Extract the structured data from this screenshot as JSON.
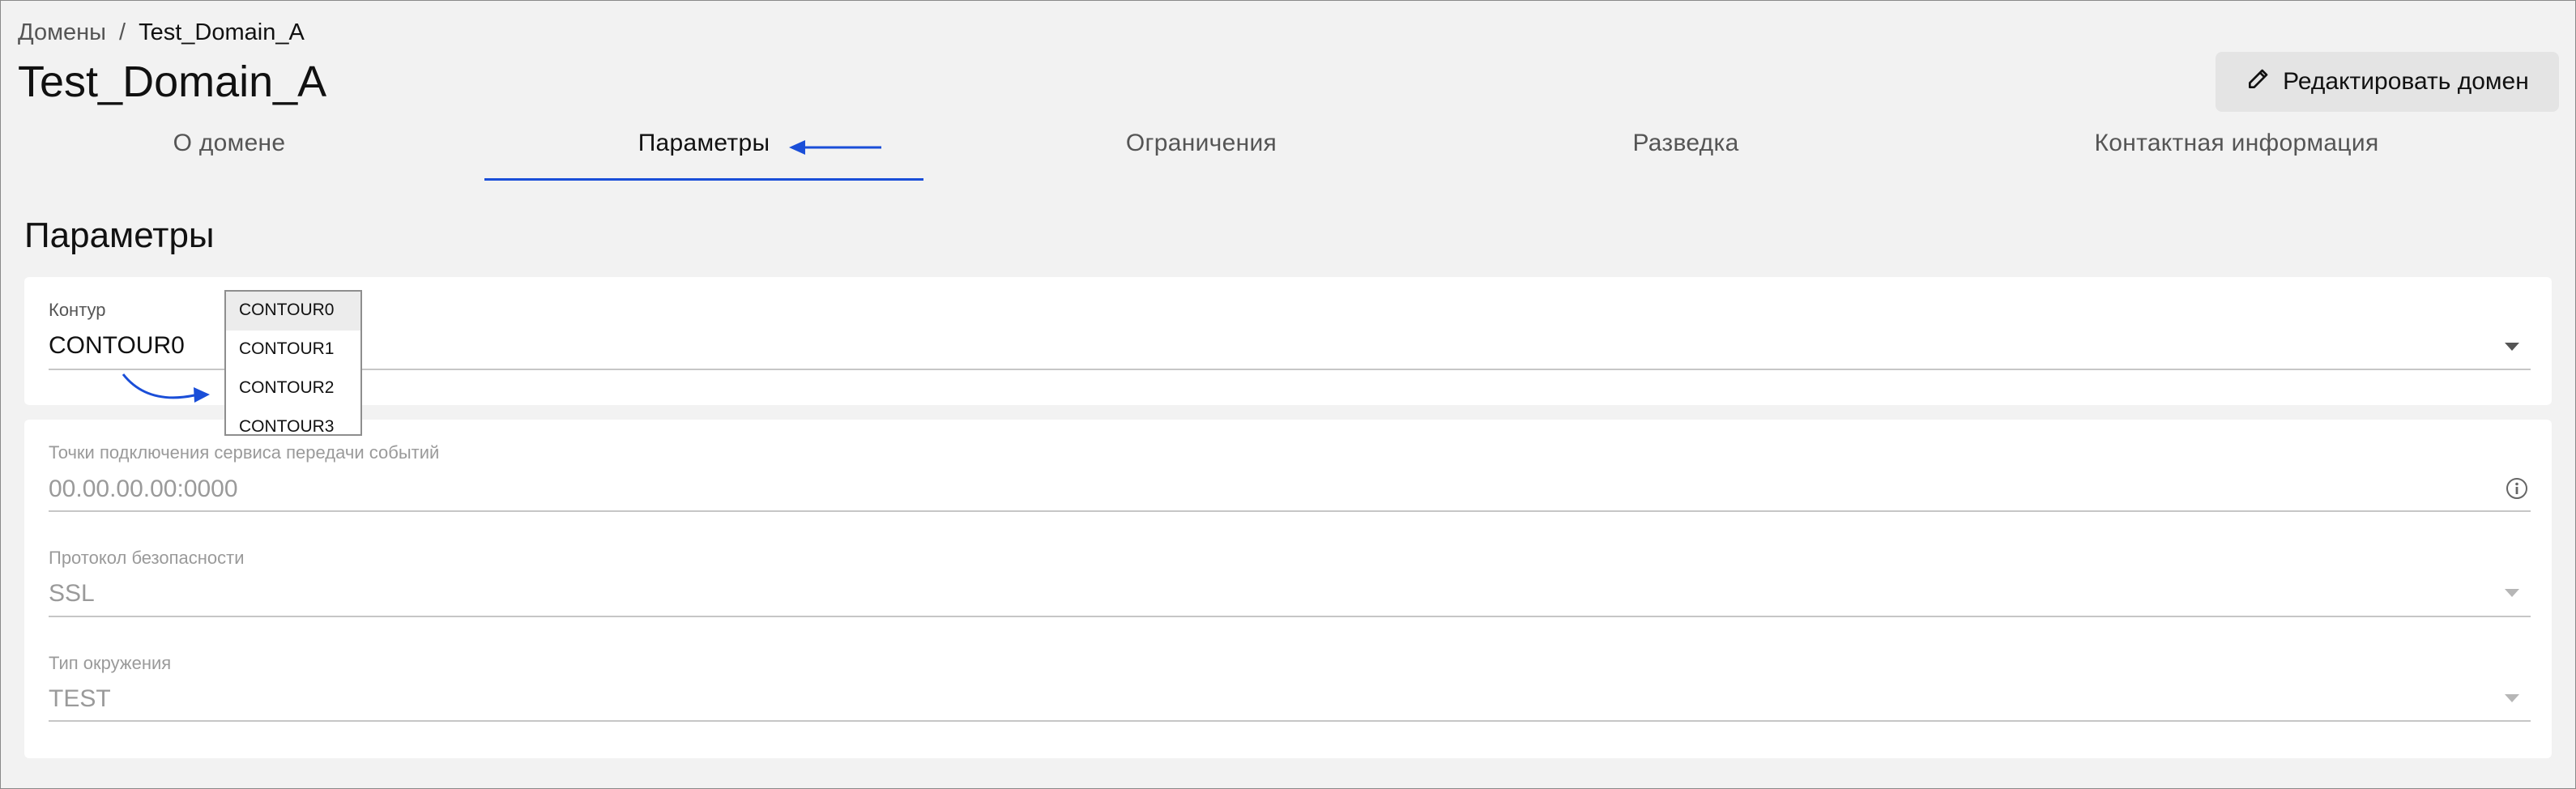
{
  "breadcrumb": {
    "root": "Домены",
    "separator": "/",
    "current": "Test_Domain_A"
  },
  "page": {
    "title": "Test_Domain_A",
    "edit_button_label": "Редактировать домен"
  },
  "tabs": [
    {
      "label": "О домене",
      "active": false
    },
    {
      "label": "Параметры",
      "active": true
    },
    {
      "label": "Ограничения",
      "active": false
    },
    {
      "label": "Разведка",
      "active": false
    },
    {
      "label": "Контактная информация",
      "active": false
    }
  ],
  "section": {
    "title": "Параметры"
  },
  "contour": {
    "label": "Контур",
    "value": "CONTOUR0",
    "options": [
      "CONTOUR0",
      "CONTOUR1",
      "CONTOUR2",
      "CONTOUR3"
    ],
    "selected_option": "CONTOUR0"
  },
  "fields": [
    {
      "label": "Точки подключения сервиса передачи событий",
      "placeholder": "00.00.00.00:0000",
      "icon": "info-icon",
      "disabled": true
    },
    {
      "label": "Протокол безопасности",
      "value": "SSL",
      "icon": "chevron-down-icon",
      "disabled": true
    },
    {
      "label": "Тип окружения",
      "value": "TEST",
      "icon": "chevron-down-icon",
      "disabled": true
    }
  ],
  "colors": {
    "accent": "#1a4ed8",
    "background": "#f2f2f2",
    "card": "#ffffff",
    "disabled_text": "#9a9a9a"
  }
}
